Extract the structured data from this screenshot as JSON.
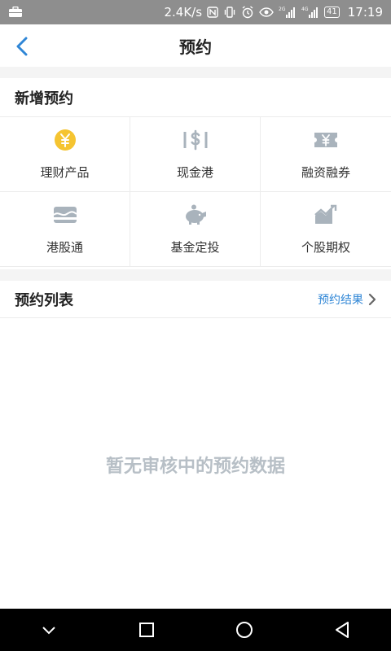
{
  "status_bar": {
    "network_speed": "2.4K/s",
    "signal_2g": "2G",
    "signal_4g": "4G",
    "battery": "41",
    "time": "17:19",
    "icons": [
      "briefcase-icon",
      "nfc-icon",
      "vibrate-icon",
      "alarm-icon",
      "eye-icon",
      "signal-icon",
      "battery-icon"
    ]
  },
  "header": {
    "title": "预约",
    "back_icon": "chevron-left-icon"
  },
  "new_reservation": {
    "title": "新增预约",
    "items": [
      {
        "label": "理财产品",
        "icon": "yuan-coin-icon"
      },
      {
        "label": "现金港",
        "icon": "cash-dollar-icon"
      },
      {
        "label": "融资融券",
        "icon": "ticket-yuan-icon"
      },
      {
        "label": "港股通",
        "icon": "card-wave-icon"
      },
      {
        "label": "基金定投",
        "icon": "piggy-bank-icon"
      },
      {
        "label": "个股期权",
        "icon": "trend-chart-icon"
      }
    ]
  },
  "reservation_list": {
    "title": "预约列表",
    "link_label": "预约结果",
    "empty_message": "暂无审核中的预约数据"
  },
  "colors": {
    "accent_blue": "#2f86d6",
    "coin_yellow": "#f5c431",
    "icon_gray": "#a9b3bc",
    "empty_text": "#b7bfc6"
  }
}
